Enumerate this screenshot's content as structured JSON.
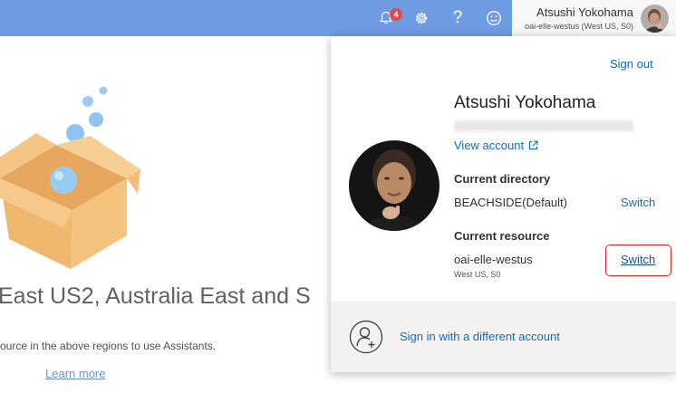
{
  "topbar": {
    "notification_count": "4",
    "icons": [
      "bell-icon",
      "gear-icon",
      "help-icon",
      "smiley-icon"
    ],
    "help_glyph": "?",
    "account_name": "Atsushi Yokohama",
    "account_sub": "oai-elle-westus (West US, S0)"
  },
  "background": {
    "heading": "East US2, Australia East and S",
    "description": "ource in the above regions to use Assistants.",
    "learn_more": "Learn more"
  },
  "panel": {
    "sign_out": "Sign out",
    "name": "Atsushi Yokohama",
    "view_account": "View account",
    "current_directory_label": "Current directory",
    "current_directory_value": "BEACHSIDE(Default)",
    "switch_label": "Switch",
    "current_resource_label": "Current resource",
    "current_resource_value": "oai-elle-westus",
    "current_resource_sub": "West US, S0",
    "footer_link": "Sign in with a different account"
  },
  "colors": {
    "topbar": "#6f9be3",
    "link": "#0f6cbd",
    "badge": "#e04a4a",
    "highlight_box": "#e02020",
    "footer": "#f3f2f1"
  }
}
